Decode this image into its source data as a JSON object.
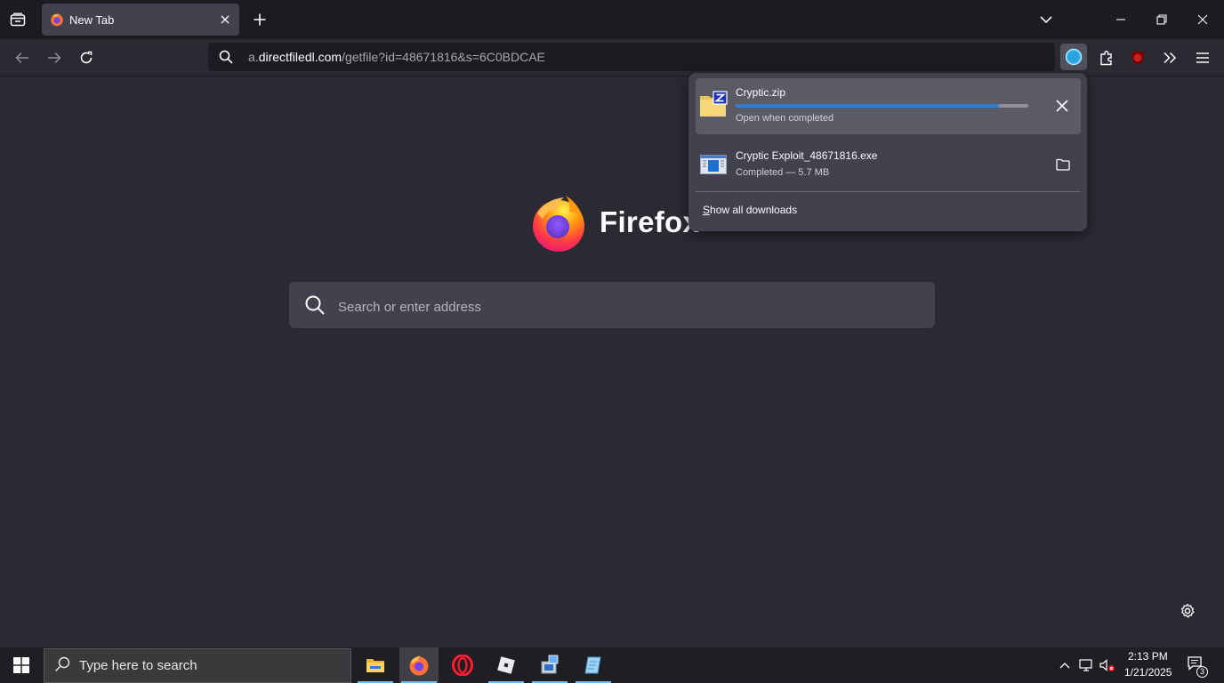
{
  "browser": {
    "tab": {
      "title": "New Tab"
    },
    "url": {
      "prefix": "a.",
      "host": "directfiledl.com",
      "path": "/getfile?id=48671816&s=6C0BDCAE"
    }
  },
  "newtab": {
    "brand": "Firefox",
    "search_placeholder": "Search or enter address"
  },
  "downloads": {
    "items": [
      {
        "name": "Cryptic.zip",
        "status": "Open when completed",
        "progress": 0.9
      },
      {
        "name": "Cryptic Exploit_48671816.exe",
        "status": "Completed — 5.7 MB"
      }
    ],
    "show_all": "Show all downloads"
  },
  "taskbar": {
    "search_placeholder": "Type here to search",
    "time": "2:13 PM",
    "date": "1/21/2025",
    "notification_count": "3"
  }
}
